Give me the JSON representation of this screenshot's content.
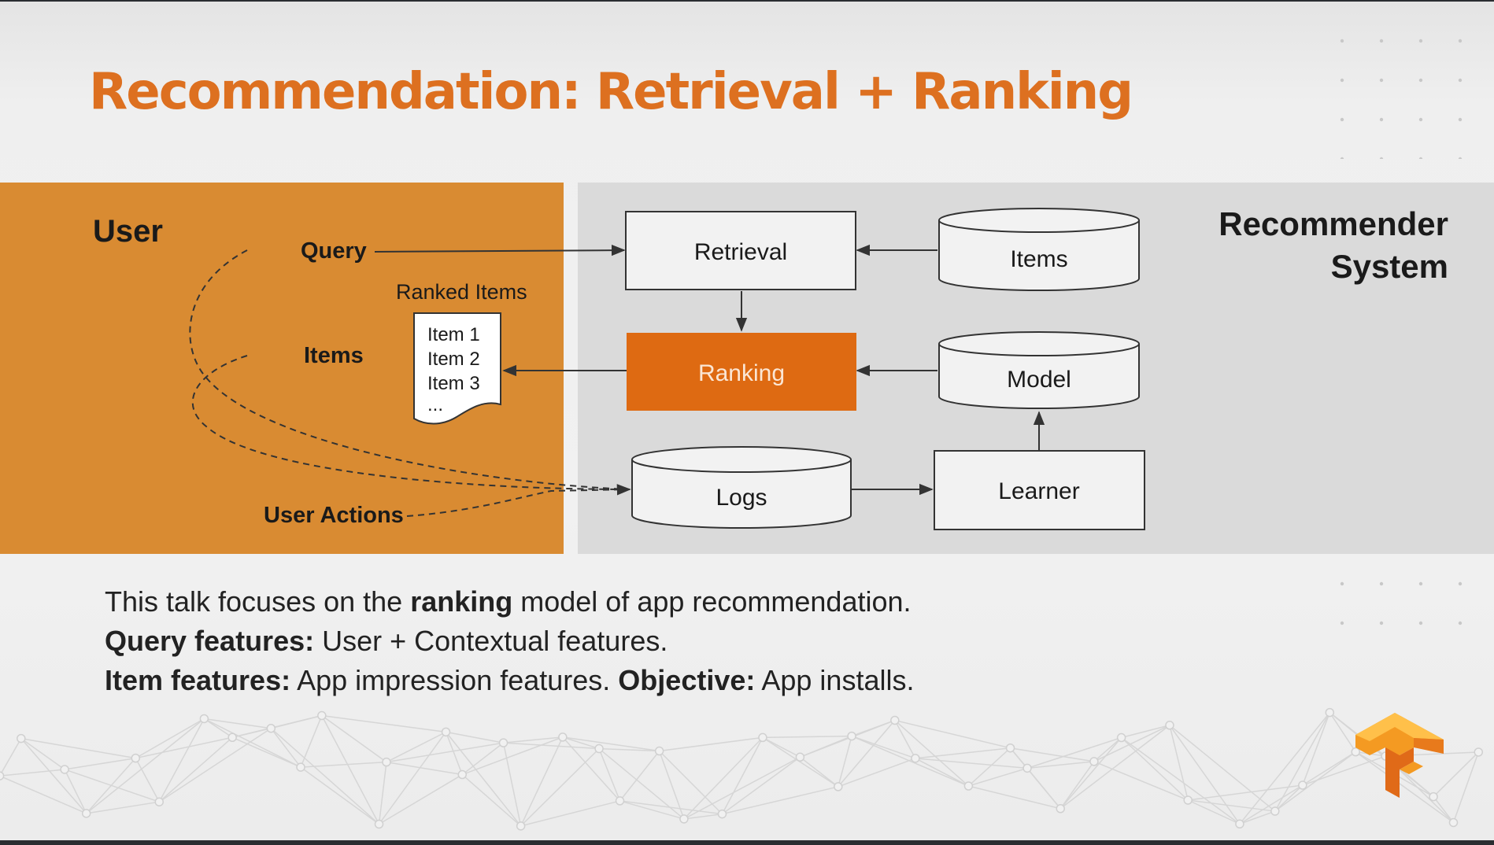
{
  "slide": {
    "title": "Recommendation: Retrieval + Ranking",
    "colors": {
      "title": "#dd7020",
      "user_panel": "#d98b32",
      "system_panel": "#dadada",
      "ranking_box": "#de6a12",
      "logo": "#f08a1a"
    }
  },
  "diagram": {
    "user_section": {
      "title": "User",
      "query_label": "Query",
      "items_label": "Items",
      "actions_label": "User Actions",
      "ranked_items": {
        "title": "Ranked Items",
        "entries": [
          "Item 1",
          "Item 2",
          "Item 3",
          "..."
        ]
      }
    },
    "system_section": {
      "title_line1": "Recommender",
      "title_line2": "System",
      "nodes": {
        "retrieval": "Retrieval",
        "items": "Items",
        "ranking": "Ranking",
        "model": "Model",
        "logs": "Logs",
        "learner": "Learner"
      }
    }
  },
  "caption": {
    "line1": {
      "pre": "This talk focuses on the ",
      "bold": "ranking",
      "post": " model of app recommendation."
    },
    "line2": {
      "bold": "Query features:",
      "post": " User + Contextual features."
    },
    "line3": {
      "bold1": "Item features:",
      "mid": " App impression features. ",
      "bold2": "Objective:",
      "post": " App installs."
    }
  },
  "logo": {
    "icon": "tensorflow-logo-icon"
  }
}
